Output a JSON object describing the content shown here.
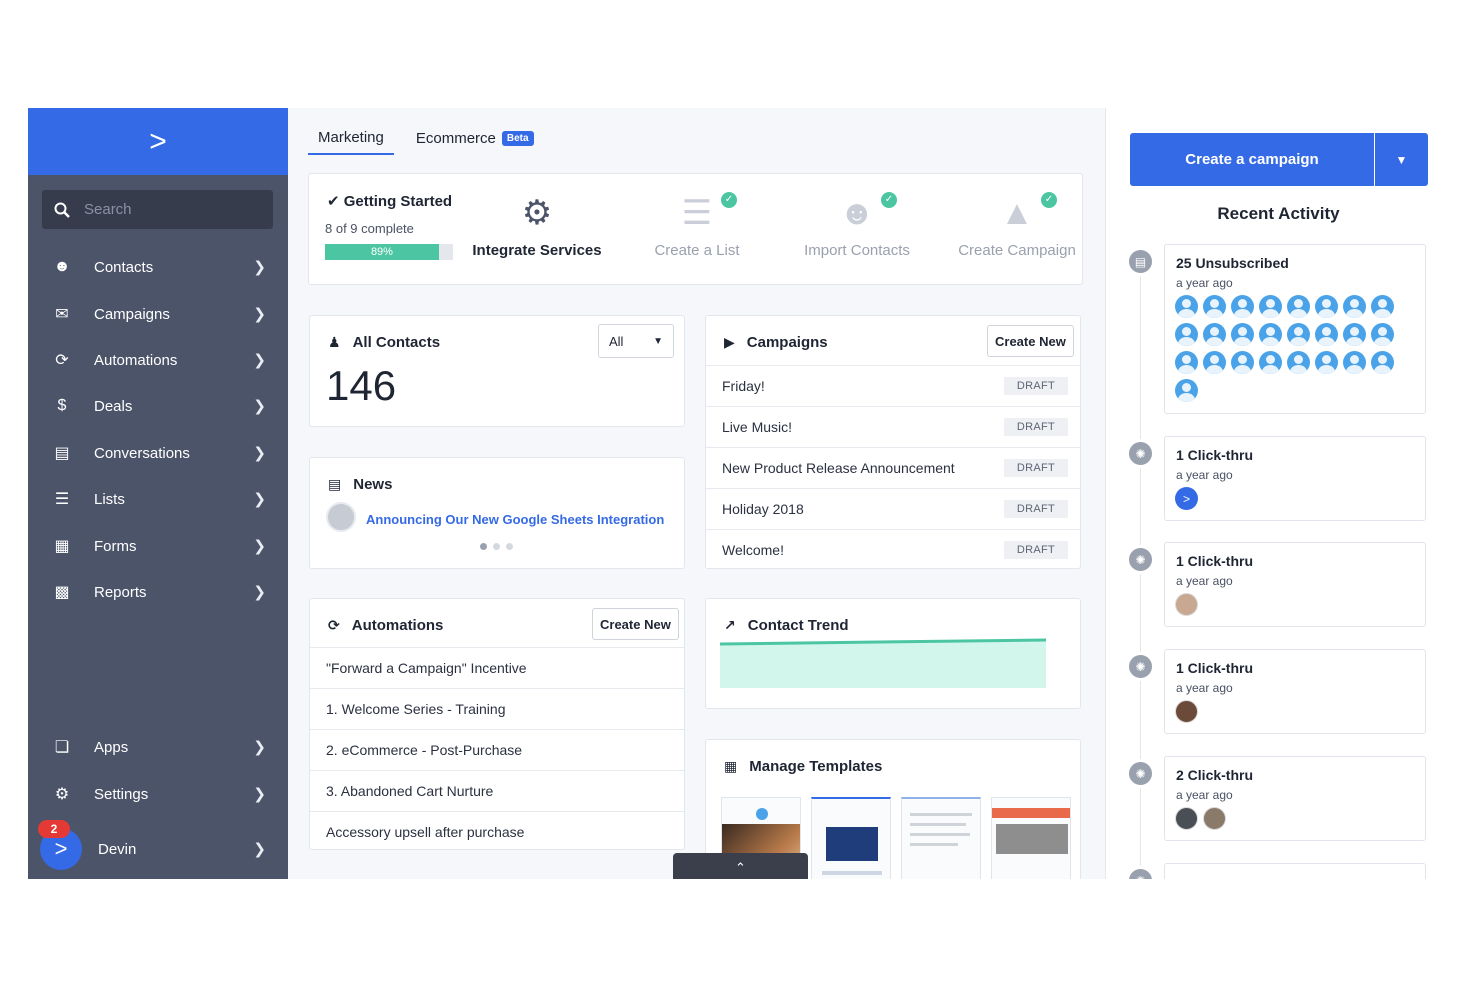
{
  "sidebar": {
    "logo": ">",
    "search_placeholder": "Search",
    "items": [
      {
        "label": "Contacts",
        "icon": "contacts-icon"
      },
      {
        "label": "Campaigns",
        "icon": "envelope-icon"
      },
      {
        "label": "Automations",
        "icon": "automations-icon"
      },
      {
        "label": "Deals",
        "icon": "dollar-icon"
      },
      {
        "label": "Conversations",
        "icon": "chat-icon"
      },
      {
        "label": "Lists",
        "icon": "list-icon"
      },
      {
        "label": "Forms",
        "icon": "form-icon"
      },
      {
        "label": "Reports",
        "icon": "bar-chart-icon"
      }
    ],
    "apps_label": "Apps",
    "settings_label": "Settings",
    "user_name": "Devin",
    "user_badge": "2"
  },
  "tabs": {
    "marketing": "Marketing",
    "ecommerce": "Ecommerce",
    "beta": "Beta"
  },
  "getting_started": {
    "title": "Getting Started",
    "progress_text": "8 of 9 complete",
    "percent_label": "89%",
    "percent": 89,
    "steps": [
      {
        "label": "Integrate Services",
        "done": false
      },
      {
        "label": "Create a List",
        "done": true
      },
      {
        "label": "Import Contacts",
        "done": true
      },
      {
        "label": "Create Campaign",
        "done": true
      }
    ]
  },
  "contacts": {
    "title": "All Contacts",
    "filter": "All",
    "count": "146"
  },
  "news": {
    "title": "News",
    "headline": "Announcing Our New Google Sheets Integration"
  },
  "automations": {
    "title": "Automations",
    "create_label": "Create New",
    "items": [
      "\"Forward a Campaign\" Incentive",
      "1. Welcome Series - Training",
      "2. eCommerce - Post-Purchase",
      "3. Abandoned Cart Nurture",
      "Accessory upsell after purchase"
    ]
  },
  "campaigns": {
    "title": "Campaigns",
    "create_label": "Create New",
    "items": [
      {
        "name": "Friday!",
        "status": "DRAFT"
      },
      {
        "name": "Live Music!",
        "status": "DRAFT"
      },
      {
        "name": "New Product Release Announcement",
        "status": "DRAFT"
      },
      {
        "name": "Holiday 2018",
        "status": "DRAFT"
      },
      {
        "name": "Welcome!",
        "status": "DRAFT"
      }
    ]
  },
  "trend": {
    "title": "Contact Trend"
  },
  "templates": {
    "title": "Manage Templates"
  },
  "right_panel": {
    "create_label": "Create a campaign",
    "recent_title": "Recent Activity",
    "activities": [
      {
        "title": "25 Unsubscribed",
        "time": "a year ago",
        "people": 25
      },
      {
        "title": "1 Click-thru",
        "time": "a year ago"
      },
      {
        "title": "1 Click-thru",
        "time": "a year ago"
      },
      {
        "title": "1 Click-thru",
        "time": "a year ago"
      },
      {
        "title": "2 Click-thru",
        "time": "a year ago"
      }
    ]
  },
  "colors": {
    "brand": "#356ae6",
    "sidebar": "#4c5469",
    "success": "#4cc6a2",
    "trend_fill": "#d3f6ec"
  }
}
